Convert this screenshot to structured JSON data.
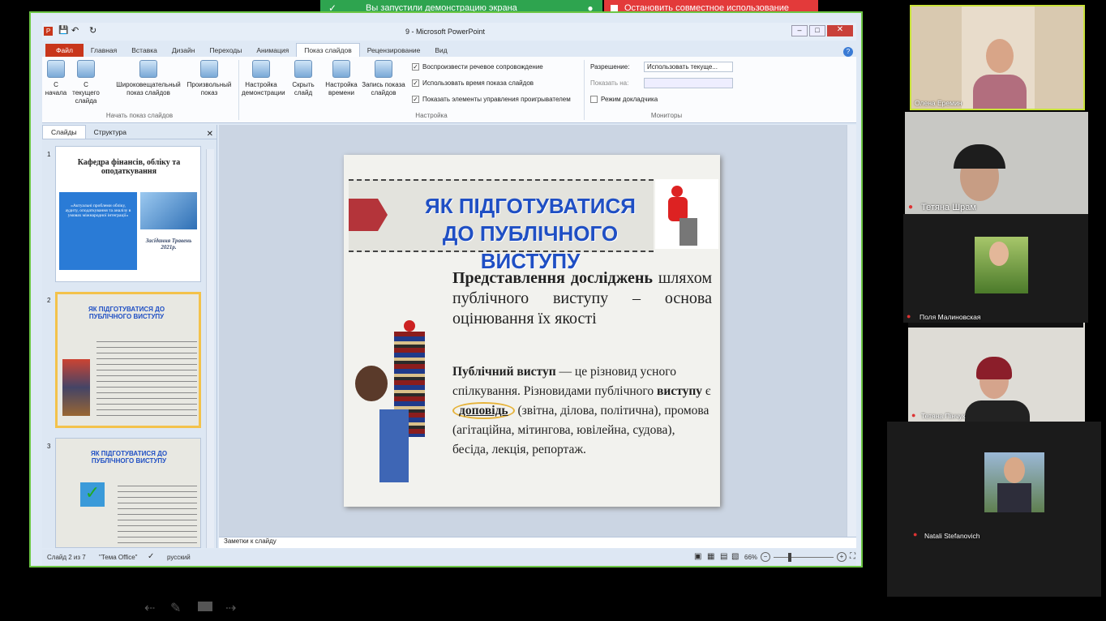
{
  "share": {
    "icon": "screen-share-icon",
    "text": "Вы запустили демонстрацию экрана",
    "stop": "Остановить совместное использование",
    "accent": "#2ea44f",
    "stop_color": "#e33a3a"
  },
  "pp": {
    "title": "9 - Microsoft PowerPoint",
    "tabs": [
      "Файл",
      "Главная",
      "Вставка",
      "Дизайн",
      "Переходы",
      "Анимация",
      "Показ слайдов",
      "Рецензирование",
      "Вид"
    ],
    "active_tab": "Показ слайдов",
    "ribbon": {
      "btn_from_start": "С начала",
      "btn_from_current": "С текущего слайда",
      "btn_broadcast": "Широковещательный показ слайдов",
      "btn_custom": "Произвольный показ",
      "group1": "Начать показ слайдов",
      "btn_setup": "Настройка демонстрации",
      "btn_hide": "Скрыть слайд",
      "btn_timing": "Настройка времени",
      "btn_record": "Запись показа слайдов",
      "chk_narration": "Воспроизвести речевое сопровождение",
      "chk_timings": "Использовать время показа слайдов",
      "chk_controls": "Показать элементы управления проигрывателем",
      "group2": "Настройка",
      "res_label": "Разрешение:",
      "res_value": "Использовать текуще...",
      "show_on": "Показать на:",
      "presenter": "Режим докладчика",
      "group3": "Мониторы"
    },
    "pane_tabs": [
      "Слайды",
      "Структура"
    ],
    "thumbs": [
      {
        "num": "1",
        "title": "Кафедра фінансів, обліку та оподаткування",
        "box": "«Актуальні проблеми обліку, аудиту, оподаткування та аналізу в умовах міжнародної інтеграції»",
        "meeting": "Засідання Травень 2021р."
      },
      {
        "num": "2",
        "title": "ЯК ПІДГОТУВАТИСЯ ДО ПУБЛІЧНОГО ВИСТУПУ"
      },
      {
        "num": "3",
        "title": "ЯК ПІДГОТУВАТИСЯ ДО ПУБЛІЧНОГО ВИСТУПУ"
      }
    ],
    "slide": {
      "heading1": "ЯК ПІДГОТУВАТИСЯ",
      "heading2": "ДО ПУБЛІЧНОГО ВИСТУПУ",
      "para1_bold": "Представлення досліджень",
      "para1_rest": "шляхом публічного виступу – основа оцінювання їх якості",
      "p2_bold": "Публічний виступ",
      "p2_a": " — це різновид усного спілкування. Різновидами публічного ",
      "p2_bold2": "виступу",
      "p2_b": " є ",
      "p2_circled": "доповідь",
      "p2_c": " (звітна, ділова, політична), промова (агітаційна, мітингова, ювілейна, судова), бесіда, лекція, репортаж."
    },
    "notes": "Заметки к слайду",
    "status": {
      "slide": "Слайд 2 из 7",
      "theme": "\"Тема Office\"",
      "lang": "русский",
      "zoom": "66%"
    }
  },
  "participants": [
    {
      "name": "Олена Еремин"
    },
    {
      "name": "Тетяна Шрам"
    },
    {
      "name": "Поля Малиновская"
    },
    {
      "name": "Тетяна Пінчук"
    },
    {
      "name": "Natali Stefanovich"
    }
  ]
}
